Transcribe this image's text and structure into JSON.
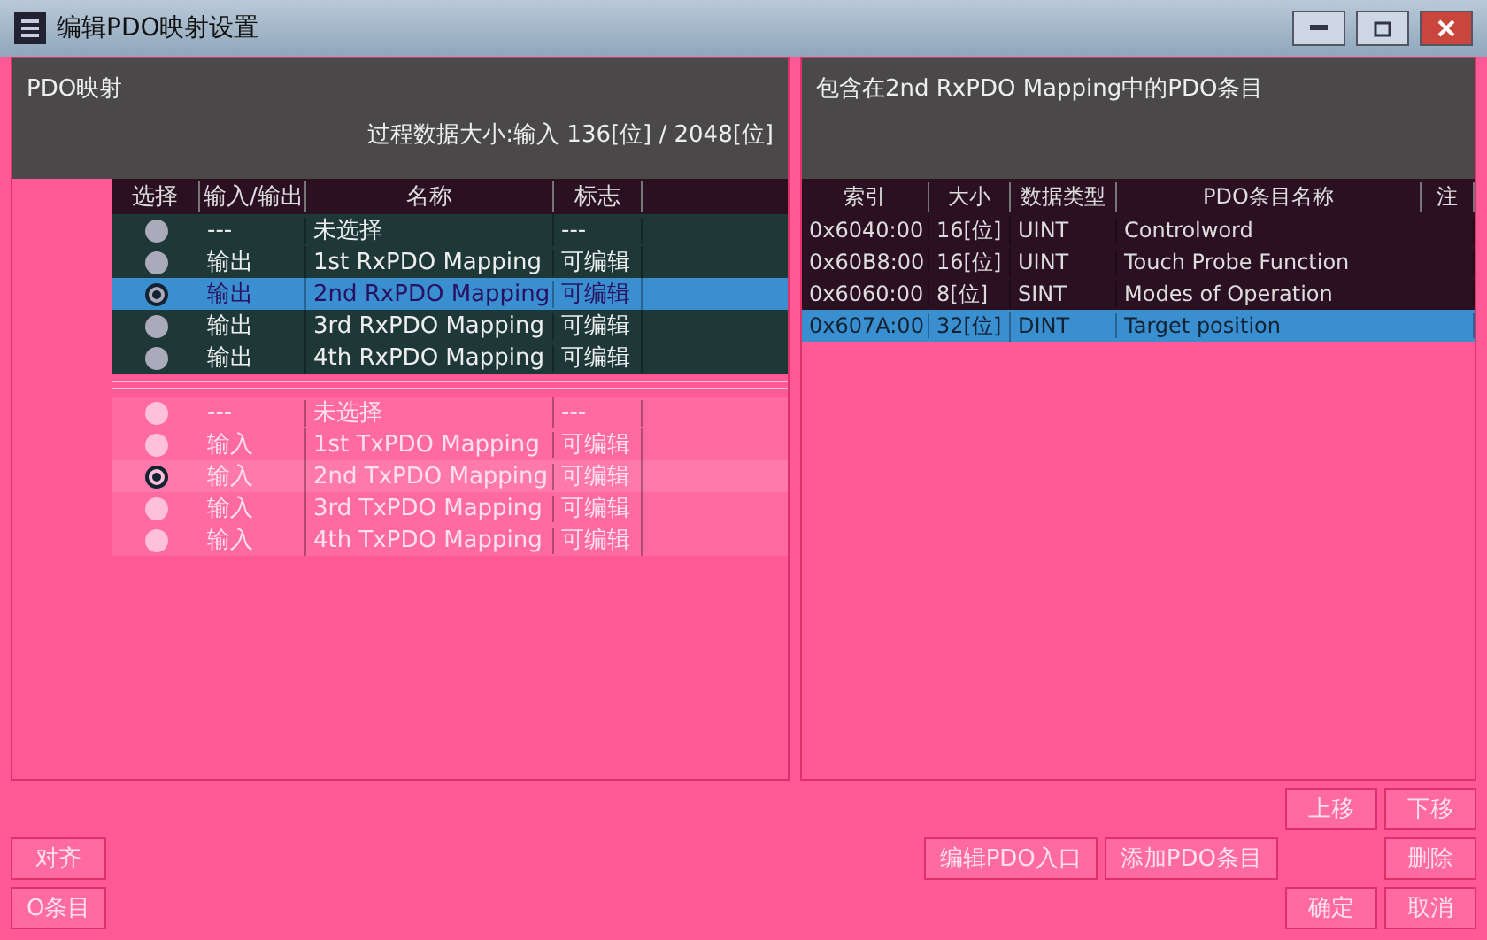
{
  "window": {
    "title": "编辑PDO映射设置"
  },
  "pdo_mapping": {
    "title": "PDO映射",
    "data_size": "过程数据大小:输入 136[位] / 2048[位]",
    "columns": [
      "选择",
      "输入/输出",
      "名称",
      "标志"
    ],
    "groups": [
      {
        "kind": "output",
        "rows": [
          {
            "direction": "---",
            "name": "未选择",
            "flag": "---",
            "selected": false
          },
          {
            "direction": "输出",
            "name": "1st RxPDO Mapping",
            "flag": "可编辑",
            "selected": false
          },
          {
            "direction": "输出",
            "name": "2nd RxPDO Mapping",
            "flag": "可编辑",
            "selected": true
          },
          {
            "direction": "输出",
            "name": "3rd RxPDO Mapping",
            "flag": "可编辑",
            "selected": false
          },
          {
            "direction": "输出",
            "name": "4th RxPDO Mapping",
            "flag": "可编辑",
            "selected": false
          }
        ]
      },
      {
        "kind": "input",
        "rows": [
          {
            "direction": "---",
            "name": "未选择",
            "flag": "---",
            "selected": false
          },
          {
            "direction": "输入",
            "name": "1st TxPDO Mapping",
            "flag": "可编辑",
            "selected": false
          },
          {
            "direction": "输入",
            "name": "2nd TxPDO Mapping",
            "flag": "可编辑",
            "selected": true
          },
          {
            "direction": "输入",
            "name": "3rd TxPDO Mapping",
            "flag": "可编辑",
            "selected": false
          },
          {
            "direction": "输入",
            "name": "4th TxPDO Mapping",
            "flag": "可编辑",
            "selected": false
          }
        ]
      }
    ],
    "side_buttons": [
      "对齐",
      "O条目"
    ]
  },
  "entries": {
    "title": "包含在2nd RxPDO Mapping中的PDO条目",
    "columns": [
      "索引",
      "大小",
      "数据类型",
      "PDO条目名称",
      "注"
    ],
    "rows": [
      {
        "index": "0x6040:00",
        "size": "16[位]",
        "type": "UINT",
        "name": "Controlword",
        "selected": false
      },
      {
        "index": "0x60B8:00",
        "size": "16[位]",
        "type": "UINT",
        "name": "Touch Probe Function",
        "selected": false
      },
      {
        "index": "0x6060:00",
        "size": "8[位]",
        "type": "SINT",
        "name": "Modes of Operation",
        "selected": false
      },
      {
        "index": "0x607A:00",
        "size": "32[位]",
        "type": "DINT",
        "name": "Target position",
        "selected": true
      }
    ]
  },
  "buttons": {
    "move_up": "上移",
    "move_down": "下移",
    "edit_entry": "编辑PDO入口",
    "add_entry": "添加PDO条目",
    "delete": "删除",
    "ok": "确定",
    "cancel": "取消"
  }
}
